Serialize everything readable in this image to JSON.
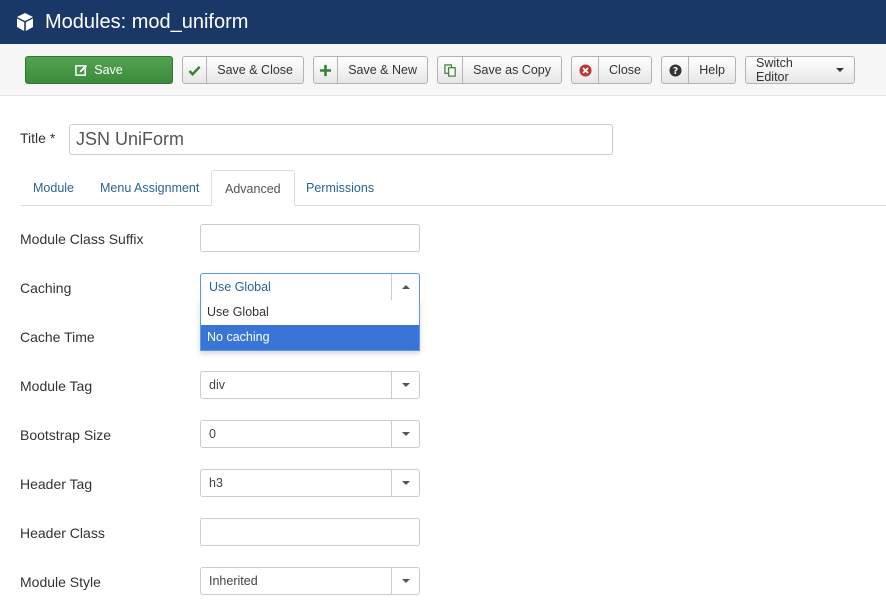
{
  "header": {
    "title": "Modules: mod_uniform",
    "icon": "cube-icon",
    "bg_color": "#1a3867"
  },
  "toolbar": {
    "save": "Save",
    "save_close": "Save & Close",
    "save_new": "Save & New",
    "save_copy": "Save as Copy",
    "close": "Close",
    "help": "Help",
    "switch_editor": "Switch Editor"
  },
  "form": {
    "title_label": "Title *",
    "title_value": "JSN UniForm"
  },
  "tabs": [
    {
      "label": "Module"
    },
    {
      "label": "Menu Assignment"
    },
    {
      "label": "Advanced"
    },
    {
      "label": "Permissions"
    }
  ],
  "fields": {
    "module_class_suffix": {
      "label": "Module Class Suffix",
      "value": ""
    },
    "caching": {
      "label": "Caching",
      "value": "Use Global",
      "options": [
        "Use Global",
        "No caching"
      ]
    },
    "cache_time": {
      "label": "Cache Time"
    },
    "module_tag": {
      "label": "Module Tag",
      "value": "div"
    },
    "bootstrap_size": {
      "label": "Bootstrap Size",
      "value": "0"
    },
    "header_tag": {
      "label": "Header Tag",
      "value": "h3"
    },
    "header_class": {
      "label": "Header Class",
      "value": ""
    },
    "module_style": {
      "label": "Module Style",
      "value": "Inherited"
    }
  }
}
